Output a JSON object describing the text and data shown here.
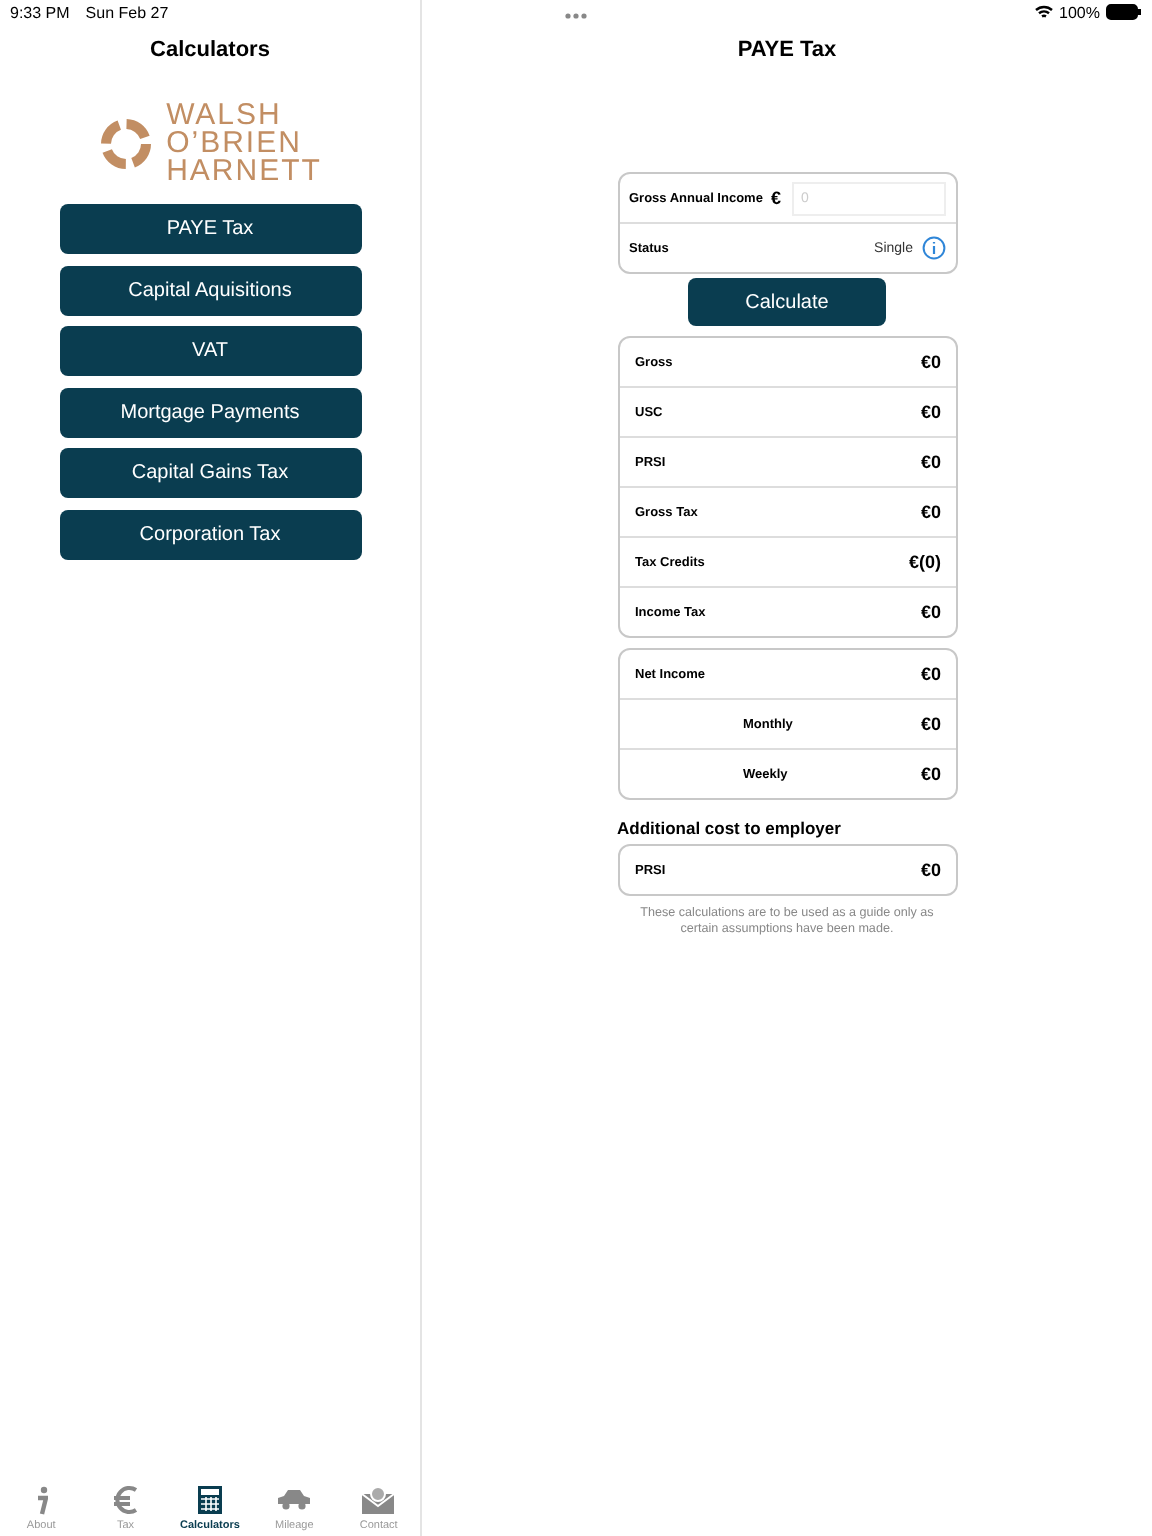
{
  "status_bar": {
    "time": "9:33 PM",
    "date": "Sun Feb 27",
    "battery": "100%"
  },
  "sidebar": {
    "title": "Calculators",
    "logo_lines": [
      "WALSH",
      "O’BRIEN",
      "HARNETT"
    ],
    "buttons": [
      {
        "label": "PAYE Tax"
      },
      {
        "label": "Capital Aquisitions"
      },
      {
        "label": "VAT"
      },
      {
        "label": "Mortgage Payments"
      },
      {
        "label": "Capital Gains Tax"
      },
      {
        "label": "Corporation Tax"
      }
    ]
  },
  "tab_bar": [
    {
      "label": "About",
      "selected": false
    },
    {
      "label": "Tax",
      "selected": false
    },
    {
      "label": "Calculators",
      "selected": true
    },
    {
      "label": "Mileage",
      "selected": false
    },
    {
      "label": "Contact",
      "selected": false
    }
  ],
  "main": {
    "title": "PAYE Tax",
    "income": {
      "label": "Gross Annual Income",
      "currency": "€",
      "placeholder": "0"
    },
    "status": {
      "label": "Status",
      "value": "Single"
    },
    "calculate_button": "Calculate",
    "results": [
      {
        "label": "Gross",
        "value": "€0",
        "kind": "main"
      },
      {
        "label": "USC",
        "value": "€0",
        "kind": "main"
      },
      {
        "label": "PRSI",
        "value": "€0",
        "kind": "main"
      },
      {
        "label": "Gross Tax",
        "value": "€0",
        "kind": "main"
      },
      {
        "label": "Tax Credits",
        "value": "€(0)",
        "kind": "main"
      },
      {
        "label": "Income Tax",
        "value": "€0",
        "kind": "main"
      }
    ],
    "net": [
      {
        "label": "Net Income",
        "value": "€0",
        "kind": "main"
      },
      {
        "label": "Monthly",
        "value": "€0",
        "kind": "sub"
      },
      {
        "label": "Weekly",
        "value": "€0",
        "kind": "sub"
      }
    ],
    "employer_heading": "Additional cost to employer",
    "employer": [
      {
        "label": "PRSI",
        "value": "€0",
        "kind": "main"
      }
    ],
    "note": "These calculations are to be used as a guide only as certain assumptions have been made."
  }
}
